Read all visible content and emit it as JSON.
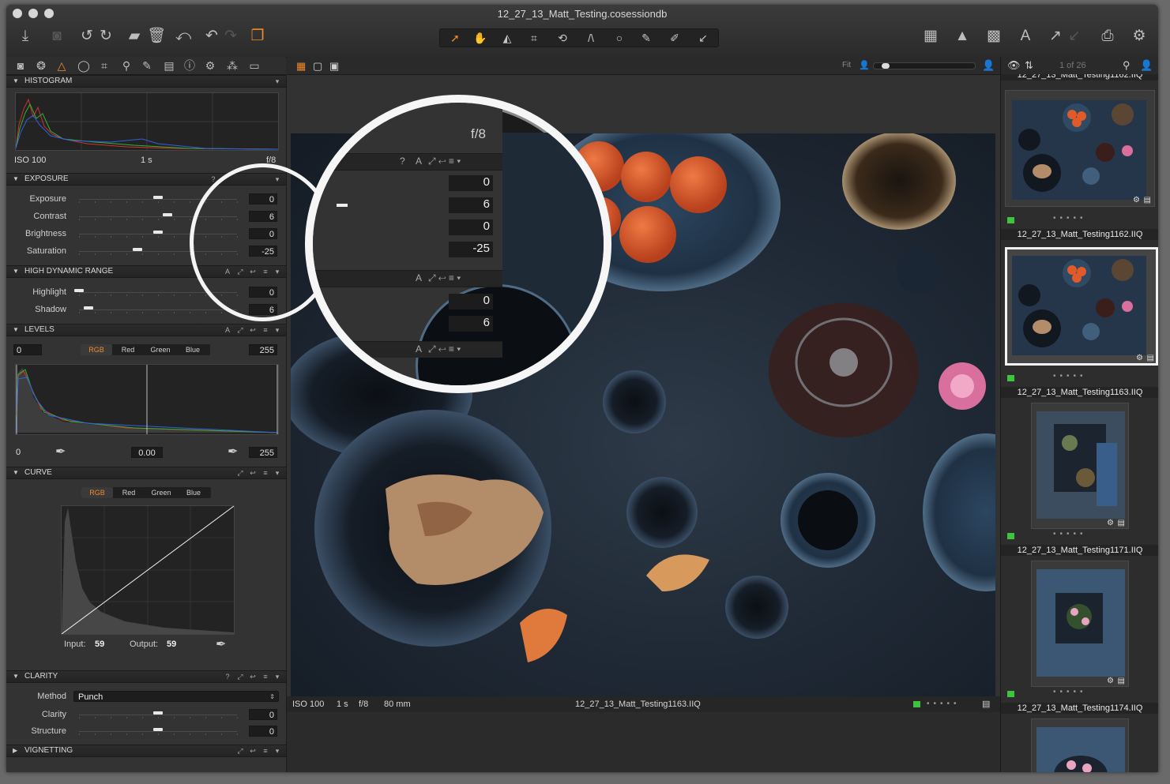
{
  "window": {
    "title": "12_27_13_Matt_Testing.cosessiondb"
  },
  "colors": {
    "accent": "#f08a2a",
    "status_green": "#3dc33d",
    "panel": "#333333"
  },
  "toolbar": {
    "left_icons": [
      "import-icon",
      "camera-icon",
      "rotate-left-icon",
      "rotate-right-icon",
      "folder-move-icon",
      "trash-icon",
      "undo-all-icon",
      "undo-icon",
      "redo-icon",
      "stack-icon"
    ],
    "cursor_tools": [
      "select-cursor-icon",
      "pan-icon",
      "loupe-icon",
      "crop-icon",
      "rotate-icon",
      "keystone-icon",
      "spot-icon",
      "brush-icon",
      "eraser-icon",
      "picker-icon"
    ],
    "right_icons": [
      "grid-icon",
      "warning-icon",
      "proof-icon",
      "text-icon",
      "export-icon",
      "export-disabled-icon",
      "print-icon",
      "gear-icon"
    ]
  },
  "tool_tabs": [
    "camera-tab-icon",
    "color-tab-icon",
    "exposure-tab-icon",
    "lens-tab-icon",
    "crop-tab-icon",
    "details-tab-icon",
    "local-adjust-tab-icon",
    "metadata-tab-icon",
    "info-tab-icon",
    "output-tab-icon",
    "batch-tab-icon",
    "library-tab-icon"
  ],
  "histogram": {
    "header": "HISTOGRAM",
    "iso": "ISO 100",
    "shutter": "1 s",
    "aperture": "f/8"
  },
  "exposure": {
    "header": "EXPOSURE",
    "header_ctl": "?",
    "rows": [
      {
        "label": "Exposure",
        "value": "0",
        "pos": 0.5
      },
      {
        "label": "Contrast",
        "value": "6",
        "pos": 0.56
      },
      {
        "label": "Brightness",
        "value": "0",
        "pos": 0.5
      },
      {
        "label": "Saturation",
        "value": "-25",
        "pos": 0.37
      }
    ]
  },
  "hdr": {
    "header": "HIGH DYNAMIC RANGE",
    "header_ctl": "A",
    "rows": [
      {
        "label": "Highlight",
        "value": "0",
        "pos": 0.0
      },
      {
        "label": "Shadow",
        "value": "6",
        "pos": 0.06
      }
    ]
  },
  "levels": {
    "header": "LEVELS",
    "header_ctl": "A",
    "left_value": "0",
    "right_value": "255",
    "channels": [
      "RGB",
      "Red",
      "Green",
      "Blue"
    ],
    "active_channel": "RGB",
    "out_left": "0",
    "midpoint": "0.00",
    "out_right": "255"
  },
  "curve": {
    "header": "CURVE",
    "channels": [
      "RGB",
      "Red",
      "Green",
      "Blue"
    ],
    "input_label": "Input:",
    "input_value": "59",
    "output_label": "Output:",
    "output_value": "59"
  },
  "clarity": {
    "header": "CLARITY",
    "header_ctl": "?",
    "method_label": "Method",
    "method_value": "Punch",
    "rows": [
      {
        "label": "Clarity",
        "value": "0",
        "pos": 0.5
      },
      {
        "label": "Structure",
        "value": "0",
        "pos": 0.5
      }
    ]
  },
  "vignetting": {
    "header": "VIGNETTING"
  },
  "viewer": {
    "fit_label": "Fit",
    "status_iso": "ISO 100",
    "status_shutter": "1 s",
    "status_aperture": "f/8",
    "status_focal": "80 mm",
    "status_filename": "12_27_13_Matt_Testing1163.IIQ"
  },
  "browser": {
    "counter": "1 of 26",
    "items": [
      {
        "name": "12_27_13_Matt_Testing1162.IIQ",
        "selected": false
      },
      {
        "name": "12_27_13_Matt_Testing1163.IIQ",
        "selected": true
      },
      {
        "name": "12_27_13_Matt_Testing1171.IIQ",
        "selected": false
      },
      {
        "name": "12_27_13_Matt_Testing1174.IIQ",
        "selected": false
      }
    ]
  },
  "magnifier": {
    "aperture": "f/8",
    "ctl_q": "?",
    "ctl_a": "A",
    "values": [
      "0",
      "6",
      "0",
      "-25",
      "0",
      "6"
    ]
  }
}
